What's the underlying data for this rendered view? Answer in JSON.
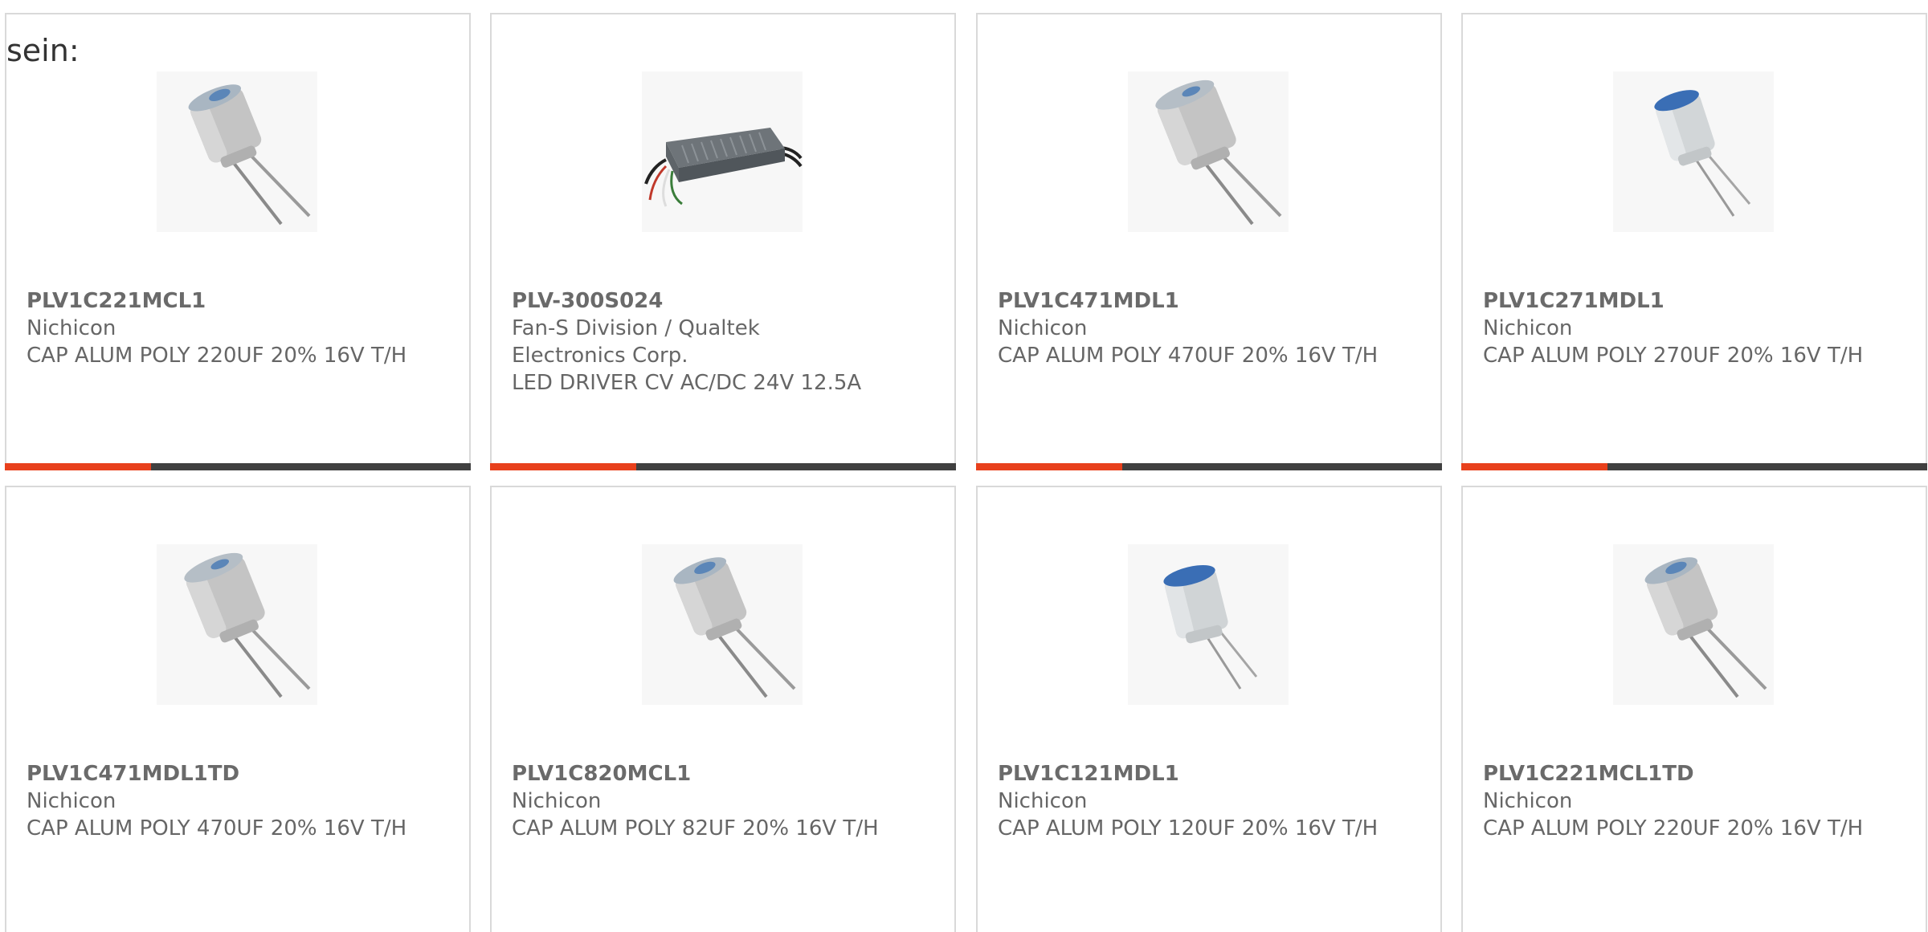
{
  "intro_text": "sein:",
  "colors": {
    "accent": "#e8401c",
    "bar": "#404040",
    "card_border": "#d9d9d9",
    "text": "#666666"
  },
  "products": [
    {
      "part": "PLV1C221MCL1",
      "maker": "Nichicon",
      "desc": "CAP ALUM POLY 220UF 20% 16V T/H",
      "image": "capacitor-gray-icon"
    },
    {
      "part": "PLV-300S024",
      "maker": "Fan-S Division / Qualtek Electronics Corp.",
      "desc": "LED DRIVER CV AC/DC 24V 12.5A",
      "image": "led-driver-icon"
    },
    {
      "part": "PLV1C471MDL1",
      "maker": "Nichicon",
      "desc": "CAP ALUM POLY 470UF 20% 16V T/H",
      "image": "capacitor-gray-icon"
    },
    {
      "part": "PLV1C271MDL1",
      "maker": "Nichicon",
      "desc": "CAP ALUM POLY 270UF 20% 16V T/H",
      "image": "capacitor-blue-top-icon"
    },
    {
      "part": "PLV1C471MDL1TD",
      "maker": "Nichicon",
      "desc": "CAP ALUM POLY 470UF 20% 16V T/H",
      "image": "capacitor-gray-icon"
    },
    {
      "part": "PLV1C820MCL1",
      "maker": "Nichicon",
      "desc": "CAP ALUM POLY 82UF 20% 16V T/H",
      "image": "capacitor-gray-icon"
    },
    {
      "part": "PLV1C121MDL1",
      "maker": "Nichicon",
      "desc": "CAP ALUM POLY 120UF 20% 16V T/H",
      "image": "capacitor-blue-top-icon"
    },
    {
      "part": "PLV1C221MCL1TD",
      "maker": "Nichicon",
      "desc": "CAP ALUM POLY 220UF 20% 16V T/H",
      "image": "capacitor-gray-icon"
    }
  ]
}
